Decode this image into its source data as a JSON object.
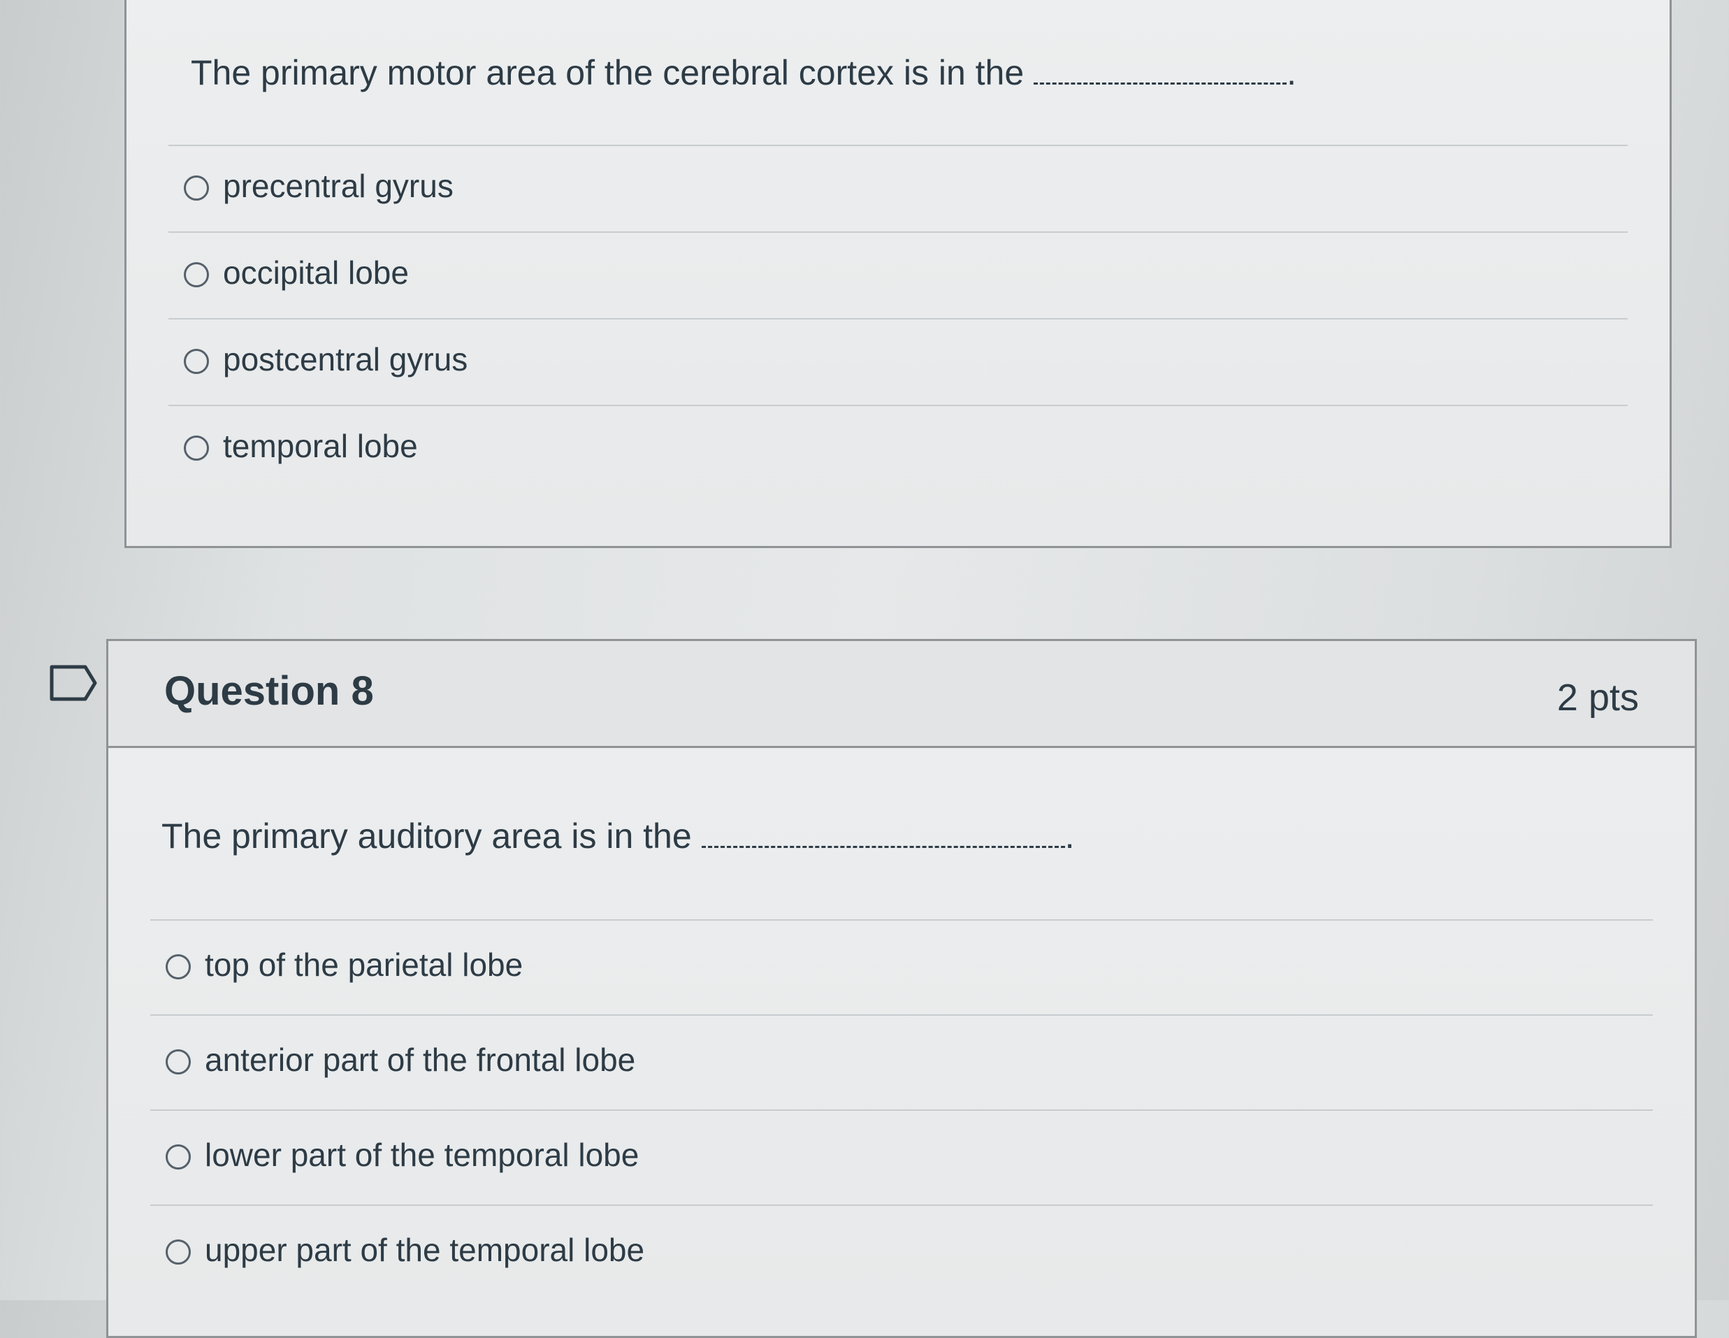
{
  "question7": {
    "text": "The primary motor area of the cerebral cortex is in the",
    "period": ".",
    "answers": [
      {
        "label": "precentral gyrus"
      },
      {
        "label": "occipital lobe"
      },
      {
        "label": "postcentral gyrus"
      },
      {
        "label": "temporal lobe"
      }
    ]
  },
  "question8": {
    "title": "Question 8",
    "points": "2 pts",
    "text": "The primary auditory area is in the",
    "period": ".",
    "answers": [
      {
        "label": "top of the parietal lobe"
      },
      {
        "label": "anterior part of the frontal lobe"
      },
      {
        "label": "lower part of the temporal lobe"
      },
      {
        "label": "upper part of the temporal lobe"
      }
    ]
  },
  "icons": {
    "flag": "flag-question-icon",
    "radio": "radio-unselected-icon"
  }
}
